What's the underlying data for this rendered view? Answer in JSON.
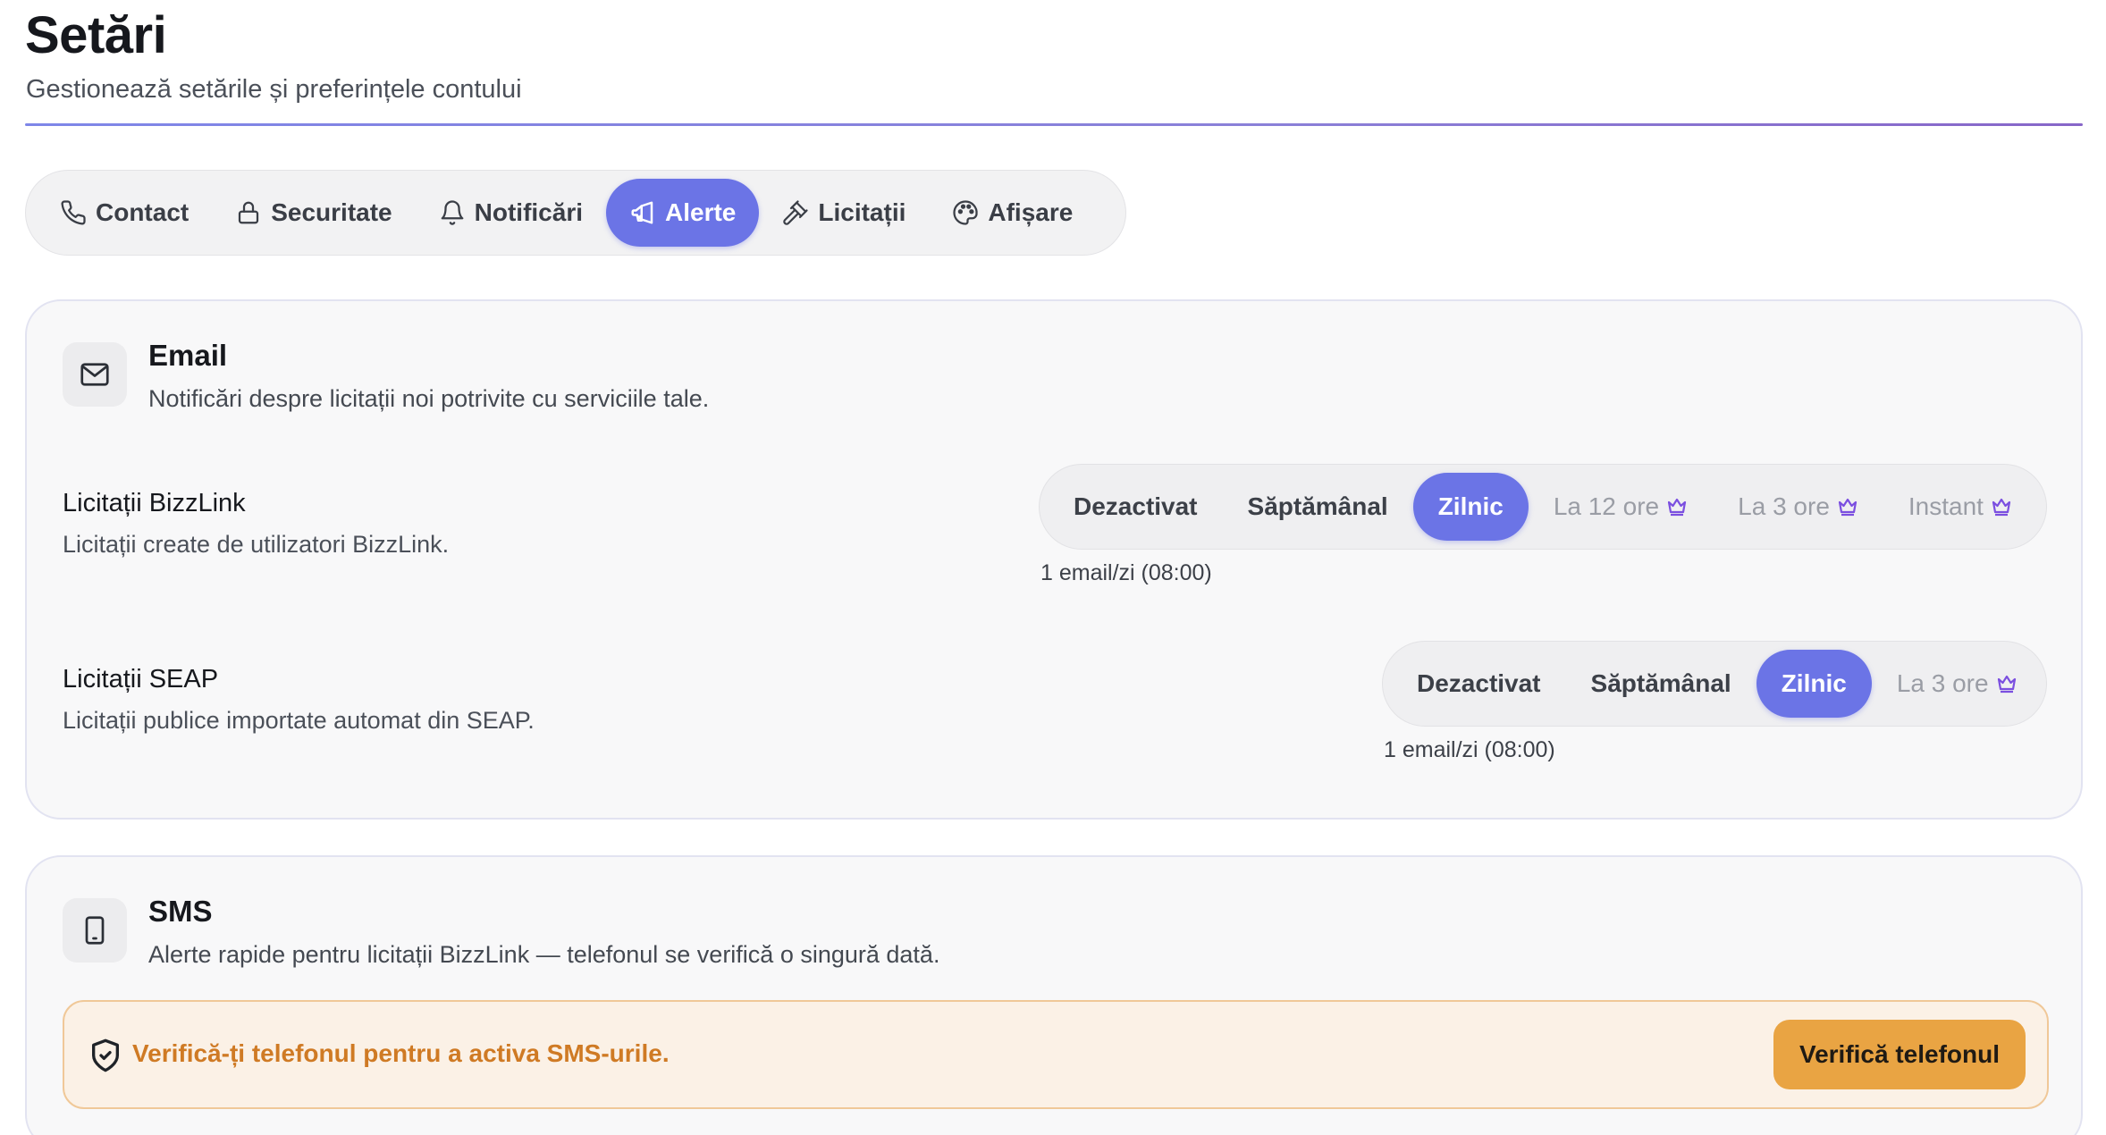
{
  "header": {
    "title": "Setări",
    "subtitle": "Gestionează setările și preferințele contului"
  },
  "tabs": [
    {
      "label": "Contact",
      "icon": "phone-icon",
      "active": false
    },
    {
      "label": "Securitate",
      "icon": "lock-icon",
      "active": false
    },
    {
      "label": "Notificări",
      "icon": "bell-icon",
      "active": false
    },
    {
      "label": "Alerte",
      "icon": "megaphone-icon",
      "active": true
    },
    {
      "label": "Licitații",
      "icon": "gavel-icon",
      "active": false
    },
    {
      "label": "Afișare",
      "icon": "palette-icon",
      "active": false
    }
  ],
  "email": {
    "title": "Email",
    "description": "Notificări despre licitații noi potrivite cu serviciile tale.",
    "bizzlink": {
      "title": "Licitații BizzLink",
      "description": "Licitații create de utilizatori BizzLink.",
      "options": [
        "Dezactivat",
        "Săptămânal",
        "Zilnic",
        "La 12 ore",
        "La 3 ore",
        "Instant"
      ],
      "selected": "Zilnic",
      "premium_options": [
        "La 12 ore",
        "La 3 ore",
        "Instant"
      ],
      "note": "1 email/zi (08:00)"
    },
    "seap": {
      "title": "Licitații SEAP",
      "description": "Licitații publice importate automat din SEAP.",
      "options": [
        "Dezactivat",
        "Săptămânal",
        "Zilnic",
        "La 3 ore"
      ],
      "selected": "Zilnic",
      "premium_options": [
        "La 3 ore"
      ],
      "note": "1 email/zi (08:00)"
    }
  },
  "sms": {
    "title": "SMS",
    "description": "Alerte rapide pentru licitații BizzLink — telefonul se verifică o singură dată.",
    "banner_text": "Verifică-ți telefonul pentru a activa SMS-urile.",
    "verify_button": "Verifică telefonul"
  },
  "colors": {
    "accent": "#6b74e6",
    "premium_crown": "#7b4fe0",
    "warning_text": "#cf7a24",
    "warning_bg": "#fbf1e6",
    "warning_button": "#e9a443"
  }
}
